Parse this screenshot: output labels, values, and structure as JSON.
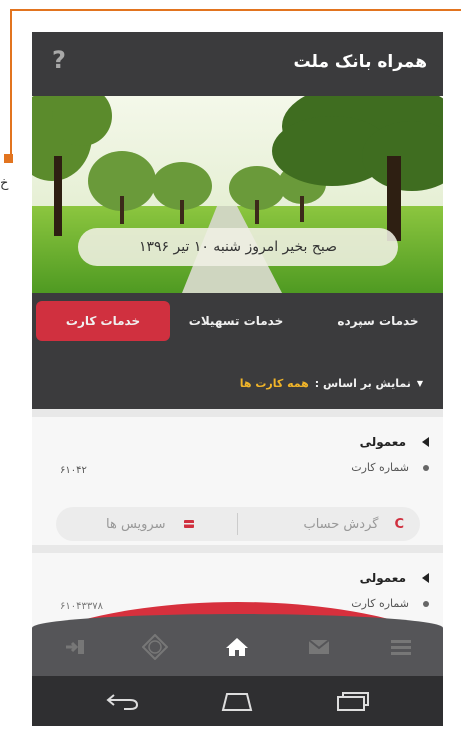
{
  "outside_text": "خ",
  "app": {
    "title": "همراه بانک ملت",
    "help_label": "?"
  },
  "hero": {
    "greeting": "صبح بخیر امروز شنبه ۱۰ تیر ۱۳۹۶"
  },
  "tabs": [
    {
      "label": "خدمات سپرده",
      "active": false
    },
    {
      "label": "خدمات تسهیلات",
      "active": false
    },
    {
      "label": "خدمات کارت",
      "active": true
    }
  ],
  "filter": {
    "label": "نمایش بر اساس :",
    "value": "همه کارت ها"
  },
  "cards": [
    {
      "type": "معمولی",
      "number_label": "شماره کارت",
      "number_value": "۶۱۰۴۲",
      "actions": {
        "balance": "گردش حساب",
        "services": "سرویس ها"
      }
    },
    {
      "type": "معمولی",
      "number_label": "شماره کارت",
      "number_value": "۶۱۰۴۳۳۷۸"
    }
  ],
  "bottom_nav": [
    "login-icon",
    "nfc-icon",
    "home-icon",
    "mail-icon",
    "menu-icon"
  ],
  "system_nav": [
    "back-icon",
    "home-outline-icon",
    "recents-icon"
  ],
  "colors": {
    "accent": "#d0303f",
    "filter_value": "#f0b429",
    "callout": "#e2741f",
    "app_bar": "#3b3b3d"
  }
}
